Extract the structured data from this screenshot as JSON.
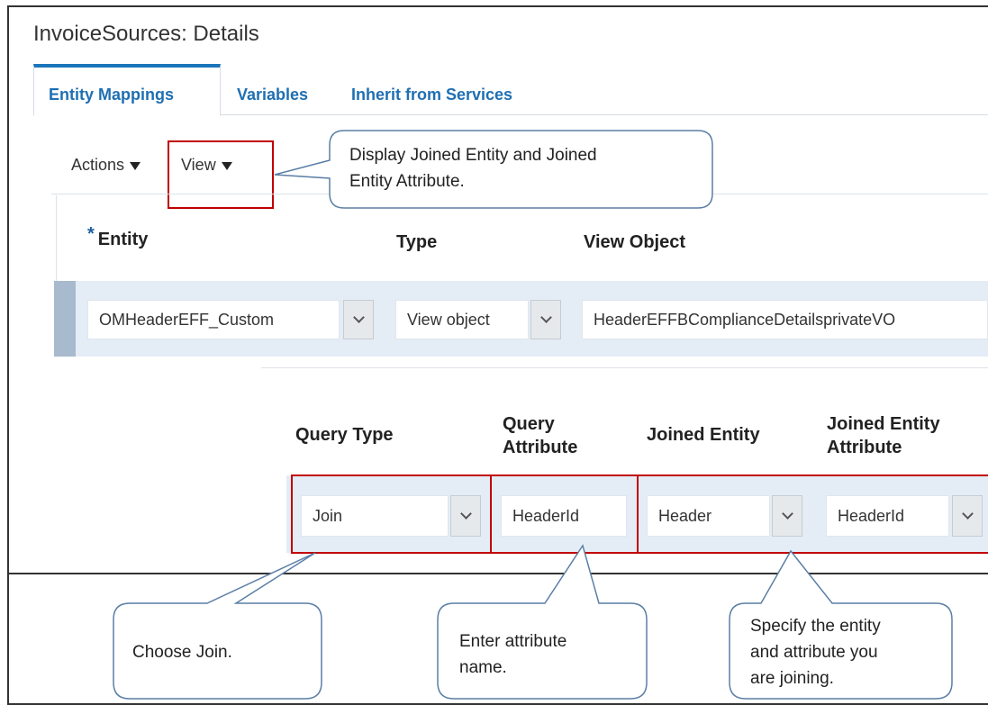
{
  "page": {
    "title": "InvoiceSources: Details"
  },
  "tabs": [
    {
      "label": "Entity Mappings",
      "active": true
    },
    {
      "label": "Variables",
      "active": false
    },
    {
      "label": "Inherit from Services",
      "active": false
    }
  ],
  "toolbar": {
    "actions_label": "Actions",
    "view_label": "View"
  },
  "entity_table": {
    "headers": {
      "entity": "Entity",
      "type": "Type",
      "view_object": "View Object"
    },
    "required_mark": "*",
    "row": {
      "entity": "OMHeaderEFF_Custom",
      "type": "View object",
      "view_object": "HeaderEFFBComplianceDetailsprivateVO"
    }
  },
  "query_table": {
    "headers": {
      "query_type": "Query Type",
      "query_attribute_line1": "Query",
      "query_attribute_line2": "Attribute",
      "joined_entity": "Joined Entity",
      "joined_entity_attribute_line1": "Joined Entity",
      "joined_entity_attribute_line2": "Attribute"
    },
    "row": {
      "query_type": "Join",
      "query_attribute": "HeaderId",
      "joined_entity": "Header",
      "joined_entity_attribute": "HeaderId"
    }
  },
  "callouts": {
    "view": {
      "line1": "Display Joined  Entity and Joined",
      "line2": "Entity Attribute."
    },
    "join": {
      "line1": "Choose Join."
    },
    "attribute": {
      "line1": "Enter attribute",
      "line2": "name."
    },
    "entity": {
      "line1": "Specify the entity",
      "line2": "and attribute you",
      "line3": "are joining."
    }
  },
  "colors": {
    "highlight_red": "#c00000",
    "tab_blue": "#1f6fb2",
    "row_band": "#e4edf6"
  },
  "icons": [
    "triangle-down-icon",
    "chevron-down-icon"
  ]
}
